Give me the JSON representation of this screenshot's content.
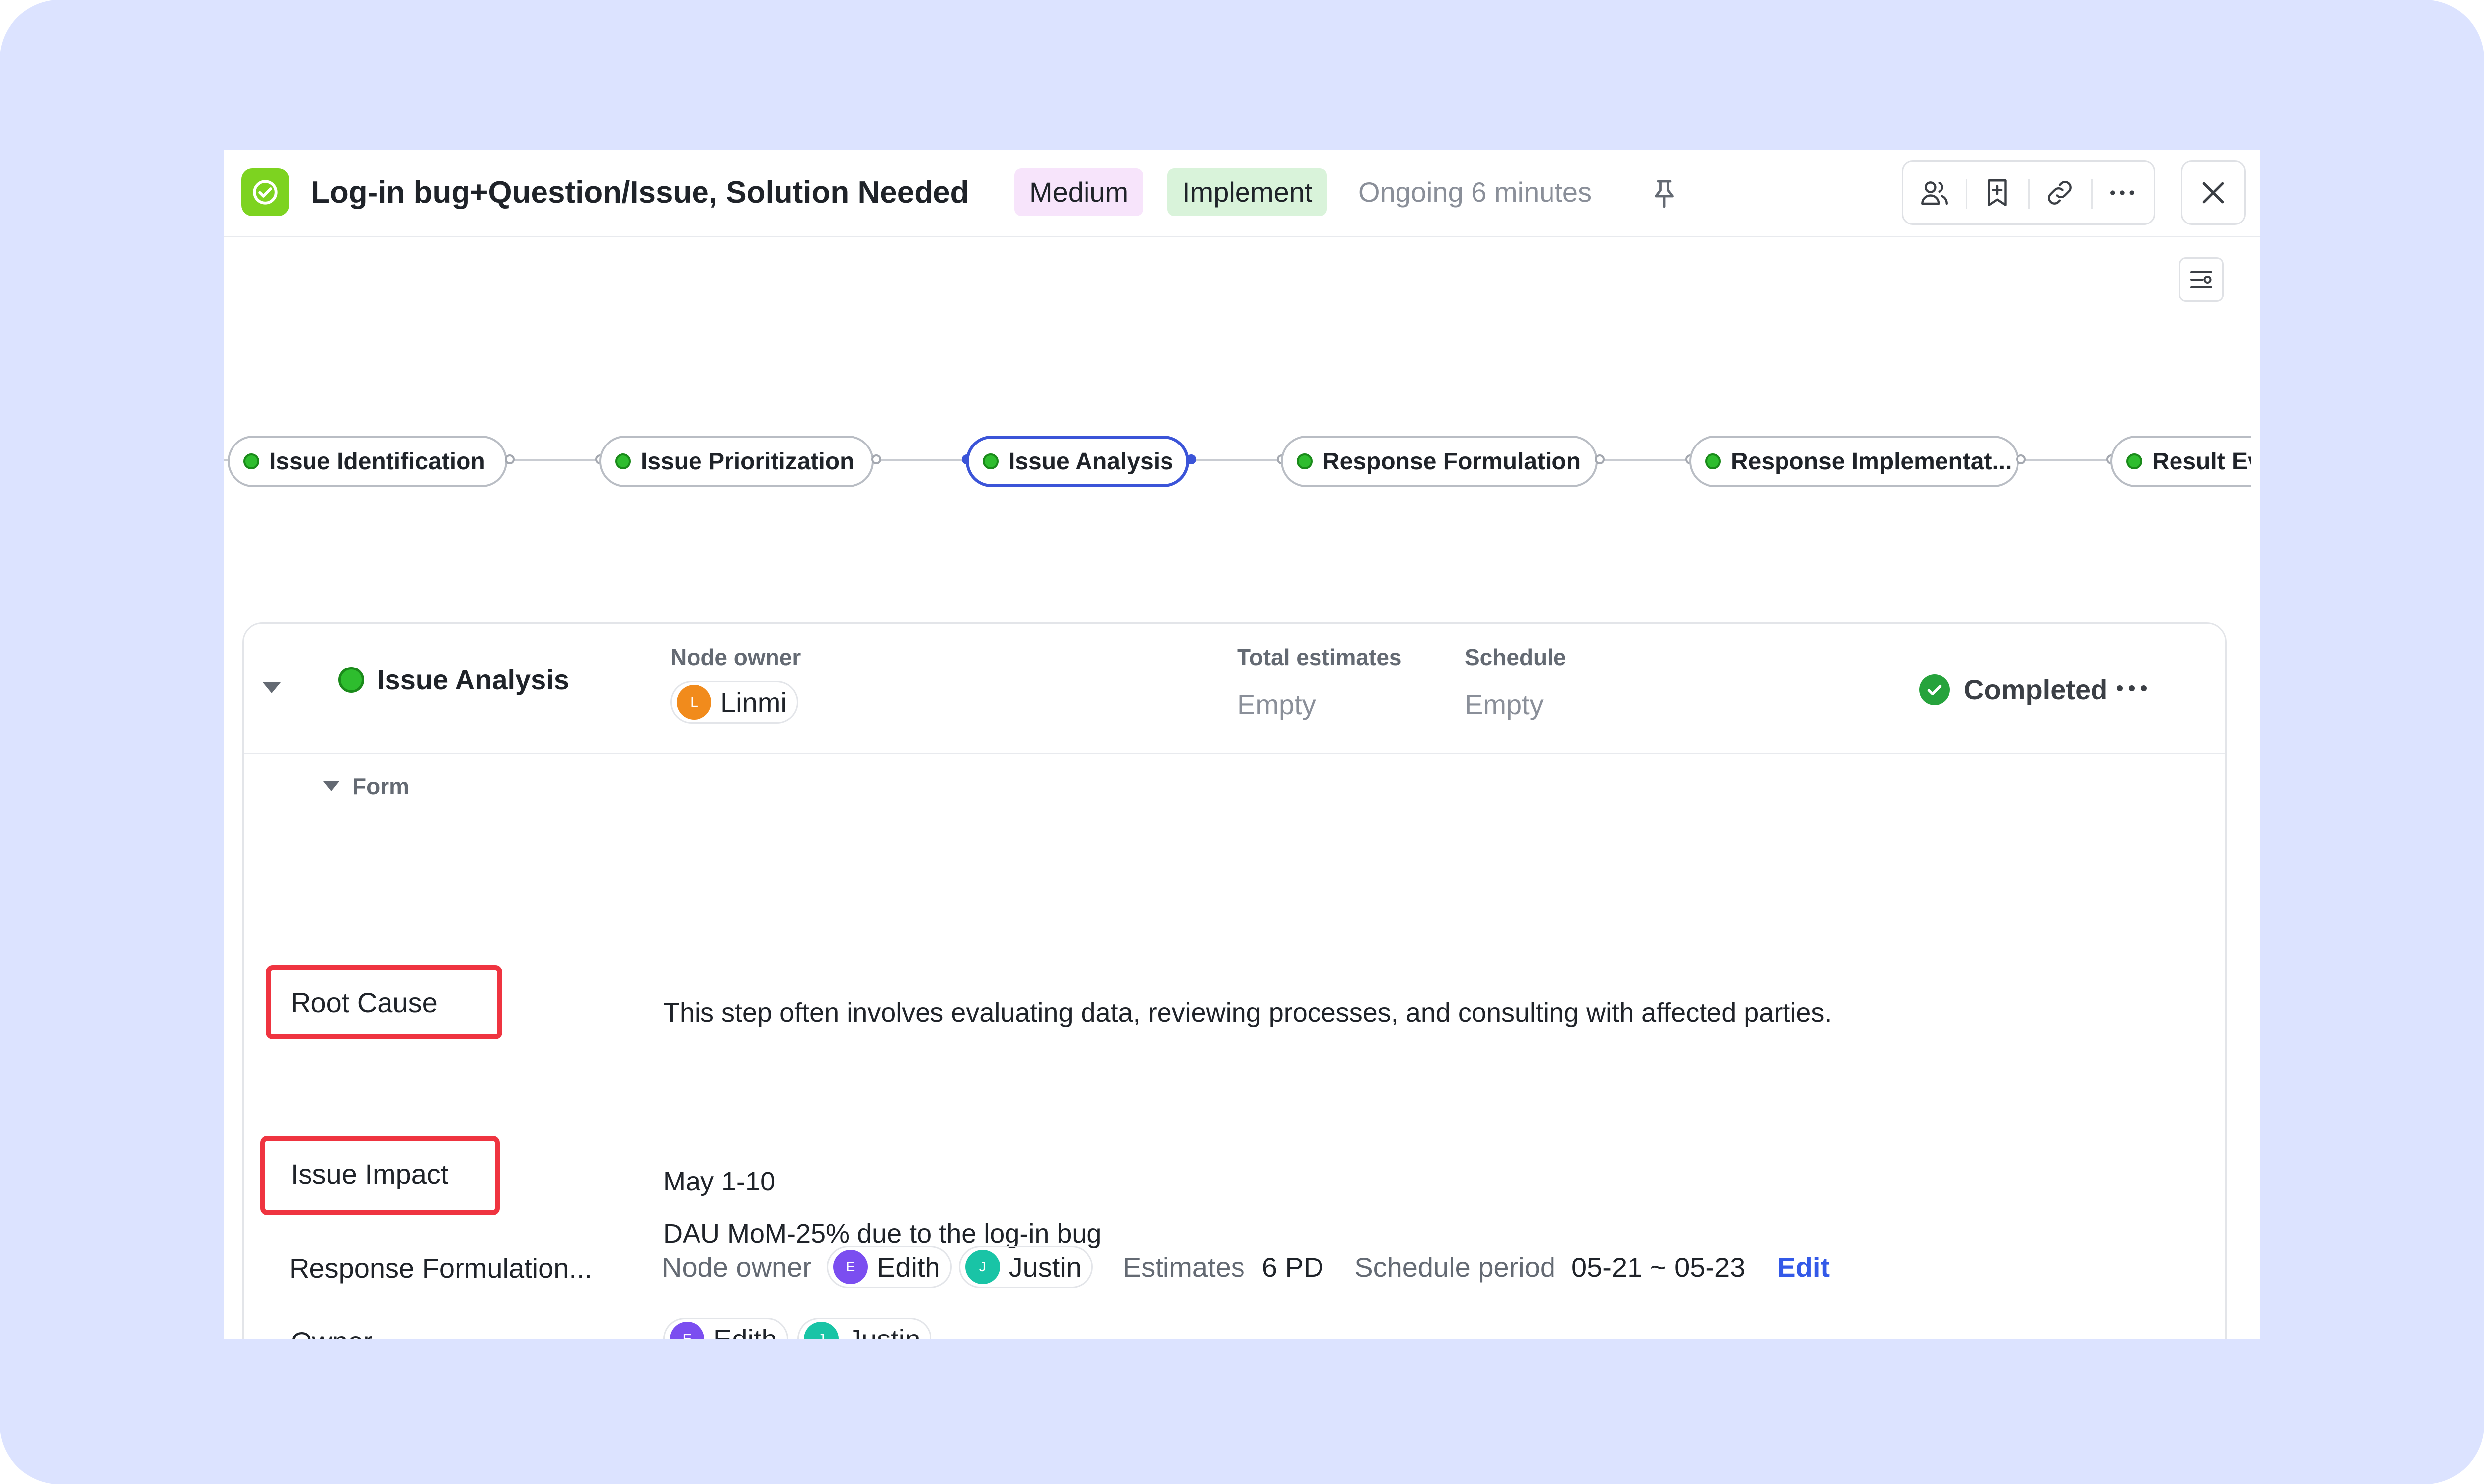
{
  "header": {
    "title": "Log-in bug+Question/Issue, Solution Needed",
    "priority_tag": "Medium",
    "stage_tag": "Implement",
    "status": "Ongoing 6 minutes"
  },
  "flow": {
    "nodes": [
      {
        "label": "Issue Identification",
        "active": false
      },
      {
        "label": "Issue Prioritization",
        "active": false
      },
      {
        "label": "Issue Analysis",
        "active": true
      },
      {
        "label": "Response Formulation",
        "active": false
      },
      {
        "label": "Response Implementat...",
        "active": false
      },
      {
        "label": "Result Ev",
        "active": false
      }
    ]
  },
  "card": {
    "title": "Issue Analysis",
    "node_owner_label": "Node owner",
    "node_owner": {
      "initial": "L",
      "name": "Linmi"
    },
    "total_estimates_label": "Total estimates",
    "total_estimates_value": "Empty",
    "schedule_label": "Schedule",
    "schedule_value": "Empty",
    "status": "Completed",
    "form_label": "Form",
    "fields": {
      "root_cause": {
        "label": "Root Cause",
        "value": "This step often involves evaluating data, reviewing processes, and consulting with affected parties."
      },
      "issue_impact": {
        "label": "Issue Impact",
        "value_line1": "May 1-10",
        "value_line2": "DAU MoM-25% due to the log-in bug"
      },
      "owner": {
        "label": "Owner",
        "people": [
          {
            "initial": "E",
            "name": "Edith"
          },
          {
            "initial": "J",
            "name": "Justin"
          }
        ]
      },
      "response": {
        "label": "Response Formulation...",
        "node_owner_label": "Node owner",
        "people": [
          {
            "initial": "E",
            "name": "Edith"
          },
          {
            "initial": "J",
            "name": "Justin"
          }
        ],
        "estimates_label": "Estimates",
        "estimates_value": "6 PD",
        "schedule_label": "Schedule period",
        "schedule_value": "05-21 ~ 05-23",
        "edit_label": "Edit"
      }
    }
  },
  "colors": {
    "accent": "#3b54d8",
    "success": "#26a33c",
    "highlight_box": "#ef3440",
    "background": "#dce3ff"
  }
}
